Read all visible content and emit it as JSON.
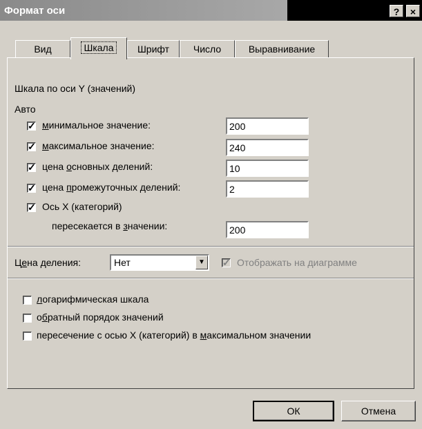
{
  "window": {
    "title": "Формат оси",
    "help_label": "?",
    "close_label": "×"
  },
  "tabs": [
    {
      "label": "Вид"
    },
    {
      "label": "Шкала"
    },
    {
      "label": "Шрифт"
    },
    {
      "label": "Число"
    },
    {
      "label": "Выравнивание"
    }
  ],
  "scale": {
    "heading": "Шкала по оси Y (значений)",
    "auto_label": "Авто",
    "check_mark": "✓",
    "min_label": "минимальное значение:",
    "min_value": "200",
    "max_label": "максимальное значение:",
    "max_value": "240",
    "major_label": "цена основных делений:",
    "major_value": "10",
    "minor_label": "цена промежуточных делений:",
    "minor_value": "2",
    "cross_label": "Ось X (категорий)",
    "cross_sub_label": "пересекается в значении:",
    "cross_value": "200",
    "division_label": "Цена деления:",
    "division_value": "Нет",
    "display_on_chart_label": "Отображать на диаграмме",
    "log_label": "логарифмическая шкала",
    "reverse_label": "обратный порядок значений",
    "cross_max_label": "пересечение с осью X (категорий) в максимальном значении"
  },
  "buttons": {
    "ok": "ОК",
    "cancel": "Отмена"
  }
}
